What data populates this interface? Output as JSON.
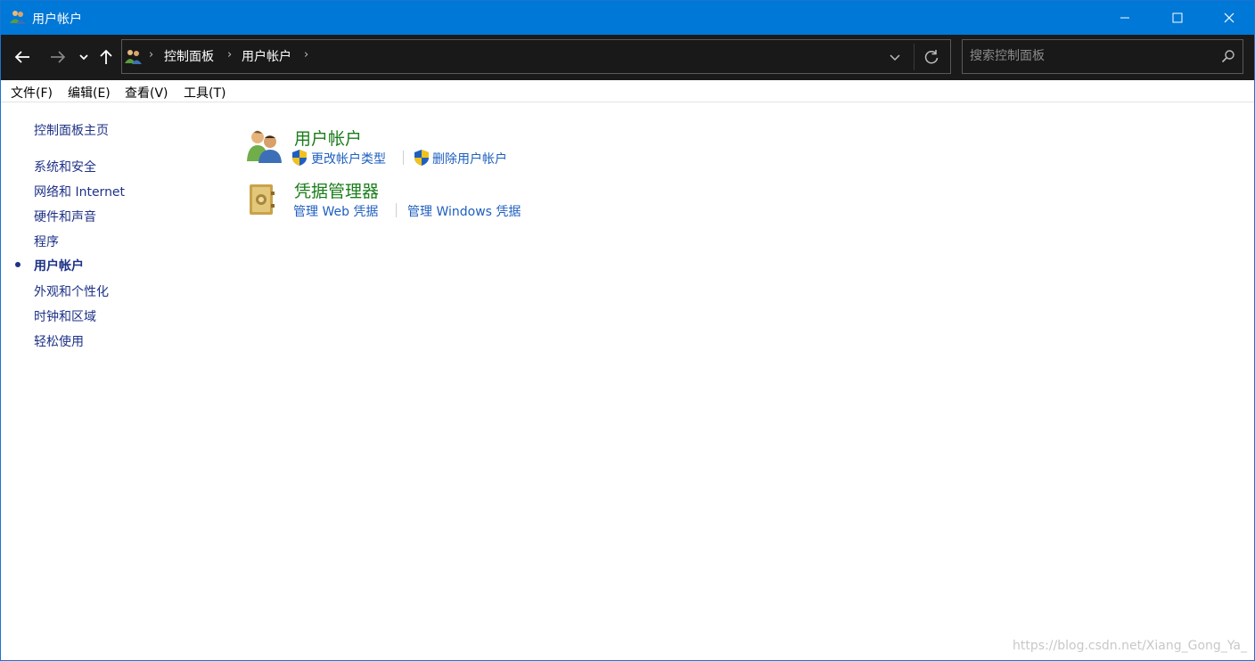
{
  "window": {
    "title": "用户帐户"
  },
  "address_bar": {
    "breadcrumbs": [
      "控制面板",
      "用户帐户"
    ]
  },
  "search": {
    "placeholder": "搜索控制面板"
  },
  "menu": [
    "文件(F)",
    "编辑(E)",
    "查看(V)",
    "工具(T)"
  ],
  "left_nav": {
    "home": "控制面板主页",
    "items": [
      "系统和安全",
      "网络和 Internet",
      "硬件和声音",
      "程序",
      "用户帐户",
      "外观和个性化",
      "时钟和区域",
      "轻松使用"
    ],
    "current": "用户帐户"
  },
  "categories": [
    {
      "title": "用户帐户",
      "links": [
        "更改帐户类型",
        "删除用户帐户"
      ]
    },
    {
      "title": "凭据管理器",
      "links": [
        "管理 Web 凭据",
        "管理 Windows 凭据"
      ]
    }
  ],
  "watermark": "https://blog.csdn.net/Xiang_Gong_Ya_",
  "colors": {
    "titlebar": "#0078d7",
    "navbar": "#1a1a1a",
    "category_title": "#1b7d1b",
    "link": "#1e5fbf",
    "left_nav": "#1e3287"
  }
}
